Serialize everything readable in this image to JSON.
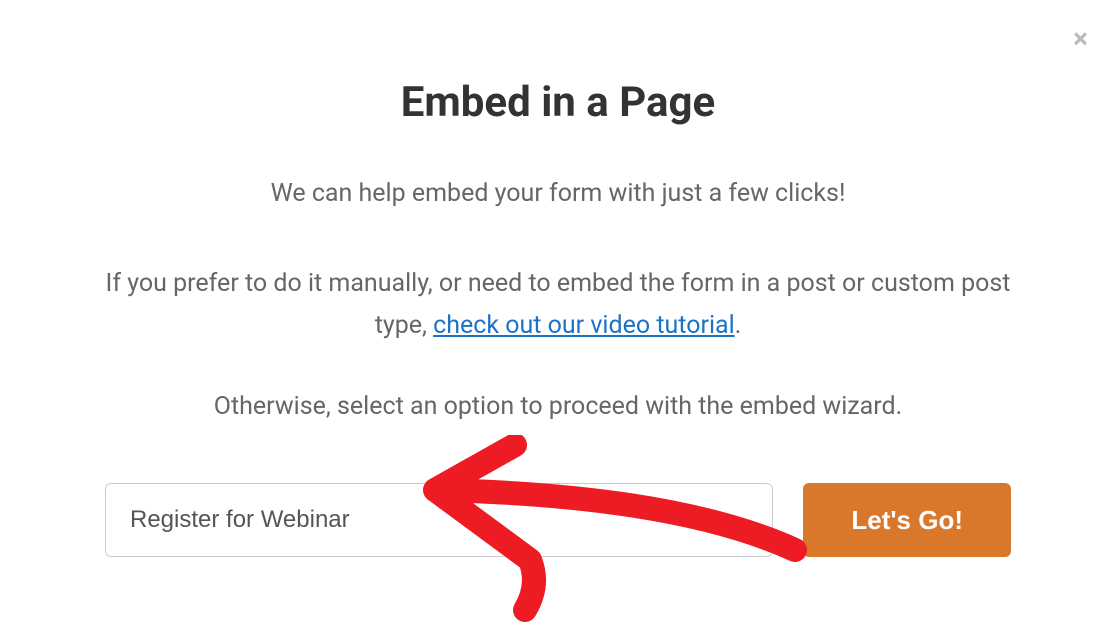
{
  "modal": {
    "title": "Embed in a Page",
    "subtitle": "We can help embed your form with just a few clicks!",
    "para1_pre": "If you prefer to do it manually, or need to embed the form in a post or custom post type, ",
    "para1_link": "check out our video tutorial",
    "para1_post": ".",
    "para2": "Otherwise, select an option to proceed with the embed wizard.",
    "input_value": "Register for Webinar",
    "button_label": "Let's Go!"
  }
}
